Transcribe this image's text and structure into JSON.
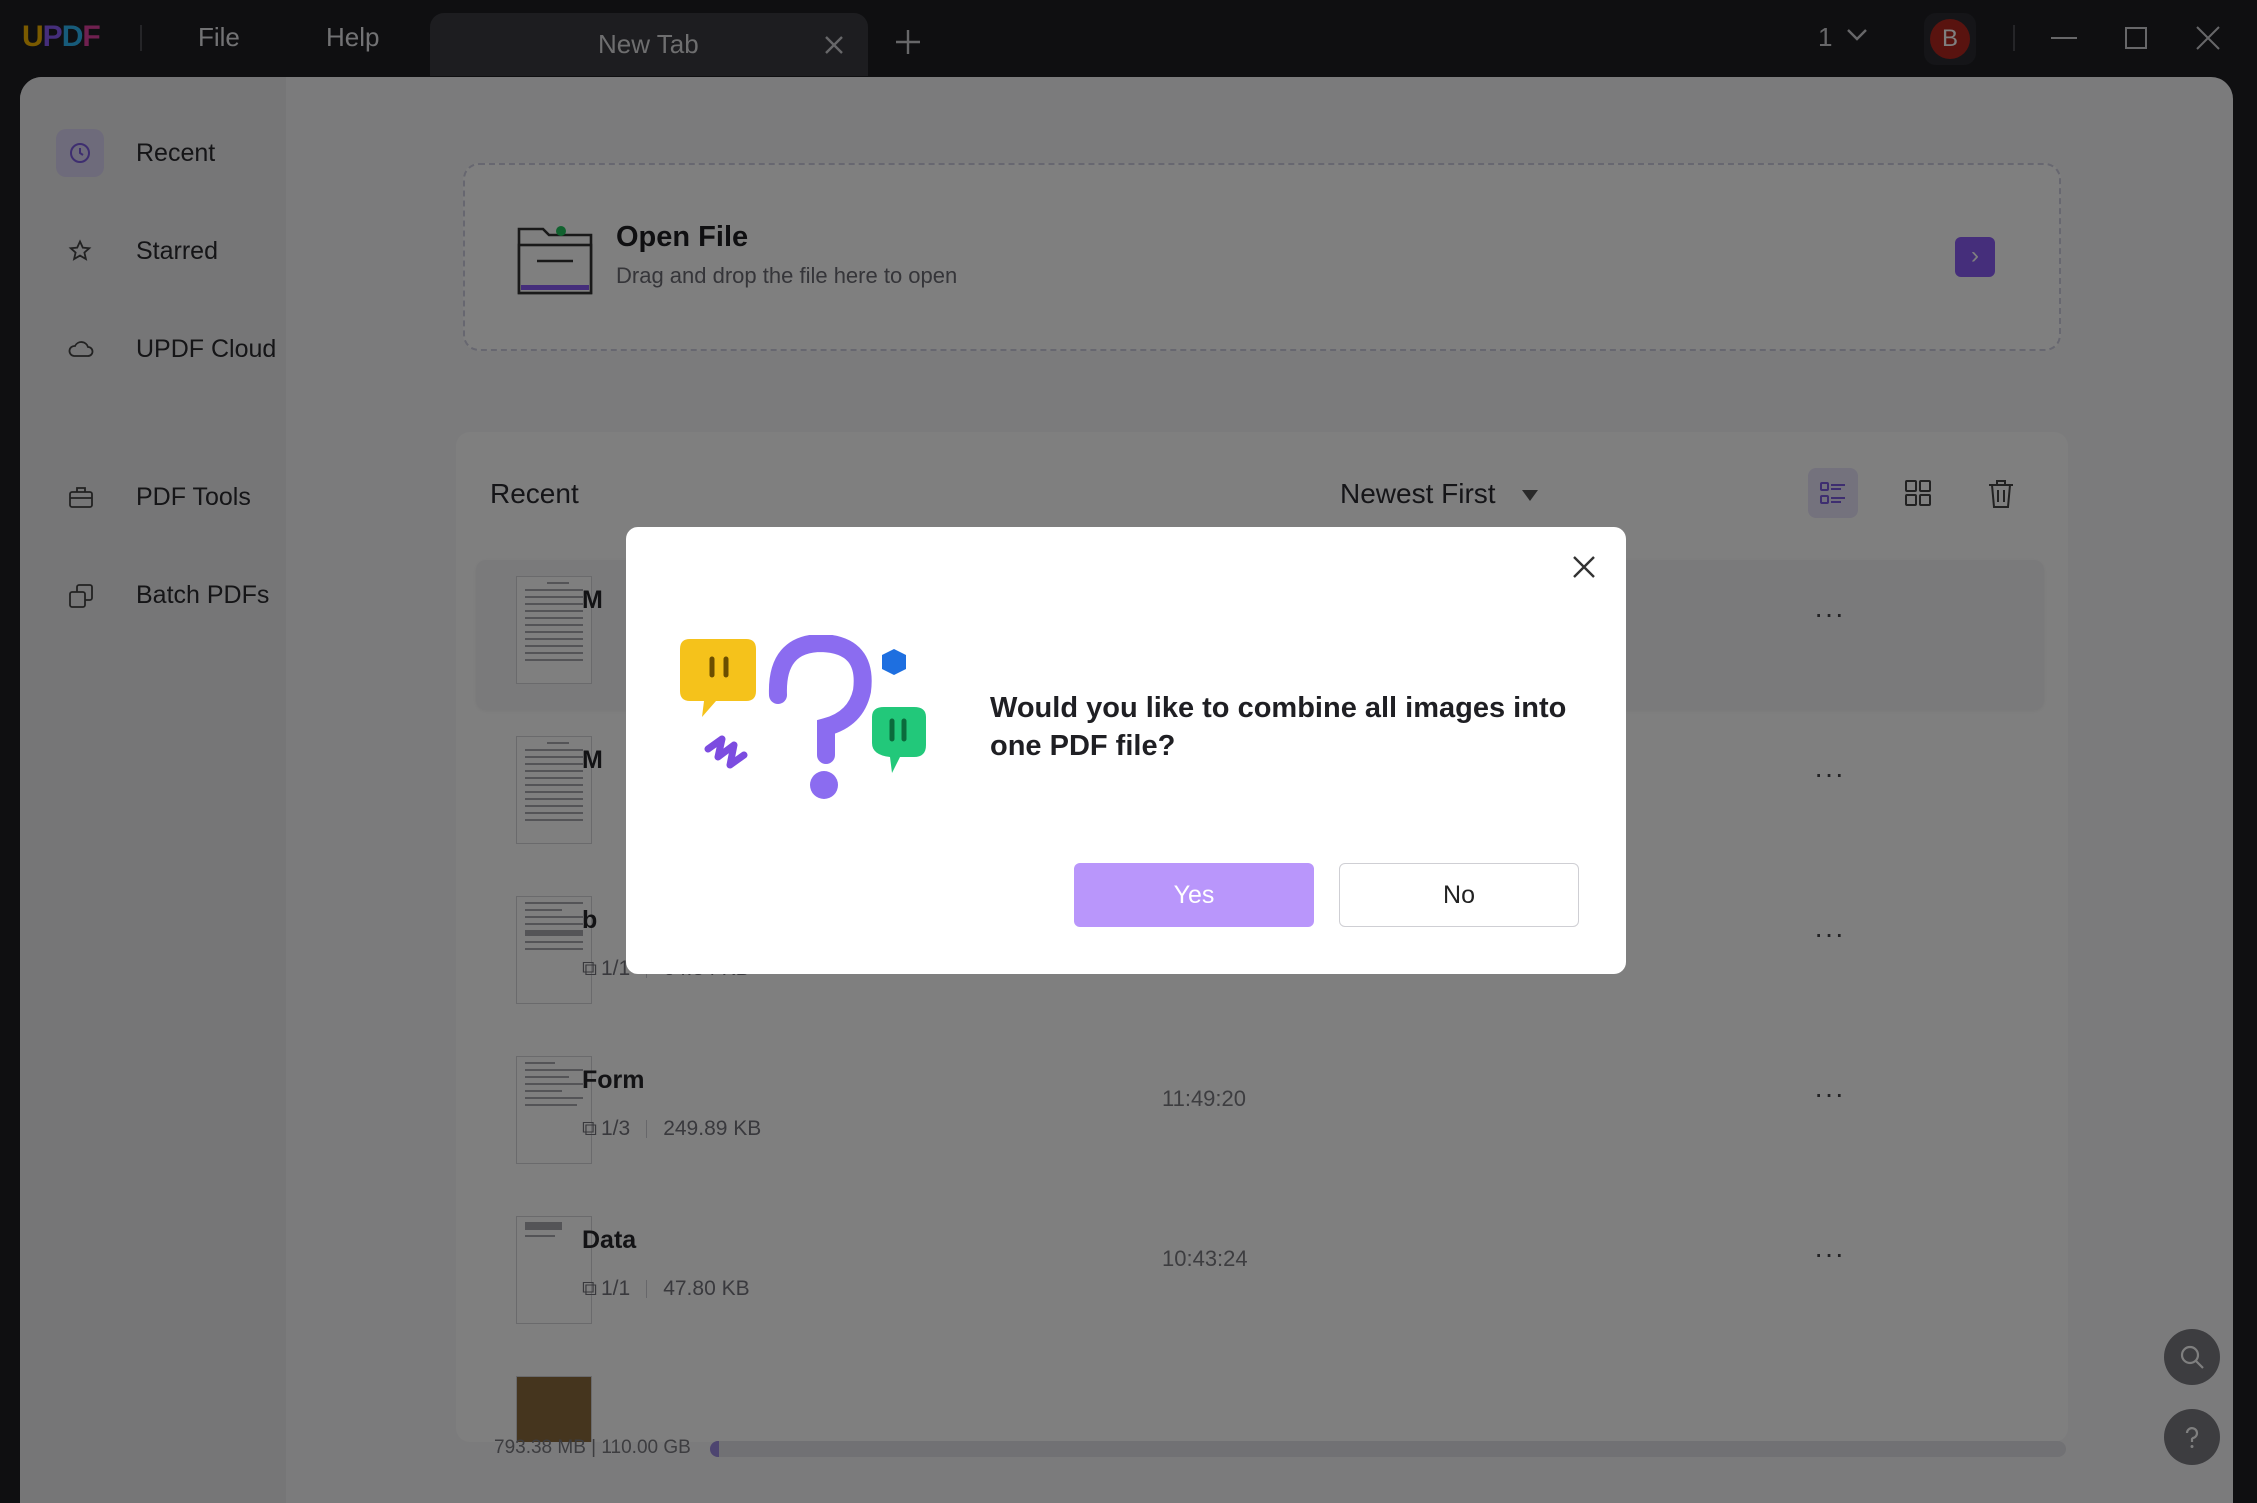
{
  "app": {
    "logo": "UPDF",
    "menu": [
      "File",
      "Help"
    ],
    "tab_title": "New Tab",
    "counter": "1",
    "avatar_initial": "B"
  },
  "sidebar": {
    "items": [
      {
        "label": "Recent",
        "icon": "clock-icon",
        "active": true
      },
      {
        "label": "Starred",
        "icon": "star-icon"
      },
      {
        "label": "UPDF Cloud",
        "icon": "cloud-icon"
      },
      {
        "label": "PDF Tools",
        "icon": "toolbox-icon"
      },
      {
        "label": "Batch PDFs",
        "icon": "batch-icon"
      }
    ]
  },
  "open_file": {
    "title": "Open File",
    "subtitle": "Drag and drop the file here to open",
    "arrow": "›"
  },
  "recent": {
    "heading": "Recent",
    "sort": "Newest First",
    "files": [
      {
        "name": "M",
        "pages": "",
        "size": "",
        "time": ""
      },
      {
        "name": "M",
        "pages": "",
        "size": "",
        "time": ""
      },
      {
        "name": "b",
        "pages": "1/1",
        "size": "64.84 KB",
        "time": ""
      },
      {
        "name": "Form",
        "pages": "1/3",
        "size": "249.89 KB",
        "time": "11:49:20"
      },
      {
        "name": "Data",
        "pages": "1/1",
        "size": "47.80 KB",
        "time": "10:43:24"
      }
    ],
    "more": "···"
  },
  "storage": {
    "text": "793.38 MB | 110.00 GB",
    "used_fraction": 0.007
  },
  "dialog": {
    "message": "Would you like to combine all images into one PDF file?",
    "yes": "Yes",
    "no": "No"
  },
  "colors": {
    "accent": "#8b5cf6",
    "yes_button": "#b996fb",
    "avatar": "#b3261e"
  }
}
